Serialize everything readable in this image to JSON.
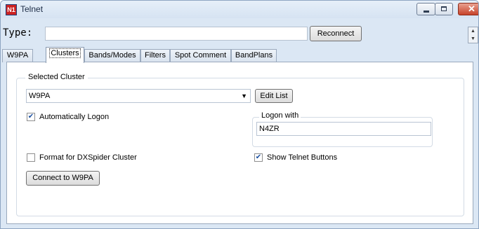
{
  "window": {
    "title": "Telnet",
    "icon_name": "n1mm-app-icon",
    "icon_text": "N1"
  },
  "command": {
    "label": "Type:",
    "value": "",
    "reconnect_label": "Reconnect"
  },
  "tabs": [
    {
      "label": "W9PA",
      "active": false
    },
    {
      "label": "Clusters",
      "active": true
    },
    {
      "label": "Bands/Modes",
      "active": false
    },
    {
      "label": "Filters",
      "active": false
    },
    {
      "label": "Spot Comment",
      "active": false
    },
    {
      "label": "BandPlans",
      "active": false
    }
  ],
  "clusters": {
    "group_label": "Selected Cluster",
    "selected_cluster": "W9PA",
    "edit_list_label": "Edit List",
    "auto_logon_label": "Automatically Logon",
    "auto_logon_checked": true,
    "logon_group_label": "Logon with",
    "logon_value": "N4ZR",
    "dxspider_label": "Format for DXSpider Cluster",
    "dxspider_checked": false,
    "show_buttons_label": "Show Telnet Buttons",
    "show_buttons_checked": true,
    "connect_label": "Connect to W9PA"
  },
  "colors": {
    "window_bg": "#dbe7f4",
    "close_button": "#c7432a"
  }
}
